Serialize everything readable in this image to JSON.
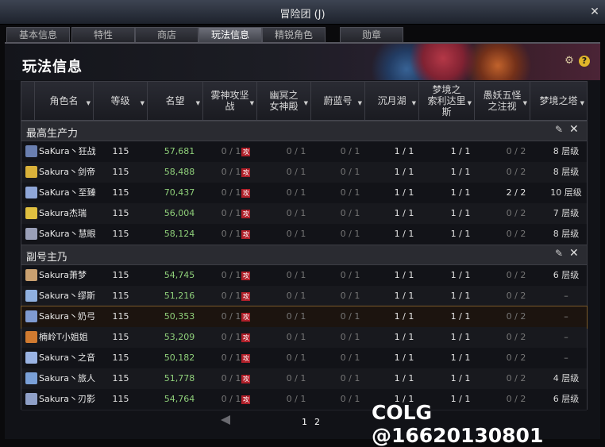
{
  "window": {
    "title": "冒险团 (J)",
    "close_glyph": "✕"
  },
  "tabs": [
    {
      "label": "基本信息"
    },
    {
      "label": "特性"
    },
    {
      "label": "商店"
    },
    {
      "label": "玩法信息"
    },
    {
      "label": "精锐角色"
    },
    {
      "label": "勋章"
    }
  ],
  "page_title": "玩法信息",
  "columns": [
    {
      "label": "角色名"
    },
    {
      "label": "等级"
    },
    {
      "label": "名望"
    },
    {
      "label": "雾神攻坚\n战"
    },
    {
      "label": "幽冥之\n女神殿"
    },
    {
      "label": "蔚蓝号"
    },
    {
      "label": "沉月湖"
    },
    {
      "label": "梦境之\n索利达里\n斯"
    },
    {
      "label": "愚妖五怪\n之注视"
    },
    {
      "label": "梦境之塔"
    }
  ],
  "groups": [
    {
      "title": "最高生产力",
      "rows": [
        {
          "name": "SaKura丶狂战",
          "level": "115",
          "fame": "57,681",
          "c1": "0 / 1",
          "c2": "0 / 1",
          "c3": "0 / 1",
          "c4": "1 / 1",
          "c5": "1 / 1",
          "c6": "0 / 2",
          "tower": "8 层级",
          "avatar": "#6a7fb0"
        },
        {
          "name": "Sakura丶剑帝",
          "level": "115",
          "fame": "58,488",
          "c1": "0 / 1",
          "c2": "0 / 1",
          "c3": "0 / 1",
          "c4": "1 / 1",
          "c5": "1 / 1",
          "c6": "0 / 2",
          "tower": "8 层级",
          "avatar": "#d9b13a"
        },
        {
          "name": "SaKura丶至臻",
          "level": "115",
          "fame": "70,437",
          "c1": "0 / 1",
          "c2": "0 / 1",
          "c3": "0 / 1",
          "c4": "1 / 1",
          "c5": "1 / 1",
          "c6": "2 / 2",
          "tower": "10 层级",
          "avatar": "#8fa6d8"
        },
        {
          "name": "Sakura杰瑞",
          "level": "115",
          "fame": "56,004",
          "c1": "0 / 1",
          "c2": "0 / 1",
          "c3": "0 / 1",
          "c4": "1 / 1",
          "c5": "1 / 1",
          "c6": "0 / 2",
          "tower": "7 层级",
          "avatar": "#e0c040"
        },
        {
          "name": "SaKura丶慧眼",
          "level": "115",
          "fame": "58,124",
          "c1": "0 / 1",
          "c2": "0 / 1",
          "c3": "0 / 1",
          "c4": "1 / 1",
          "c5": "1 / 1",
          "c6": "0 / 2",
          "tower": "8 层级",
          "avatar": "#9aa0b8"
        }
      ]
    },
    {
      "title": "副号主乃",
      "rows": [
        {
          "name": "Sakura萧梦",
          "level": "115",
          "fame": "54,745",
          "c1": "0 / 1",
          "c2": "0 / 1",
          "c3": "0 / 1",
          "c4": "1 / 1",
          "c5": "1 / 1",
          "c6": "0 / 2",
          "tower": "6 层级",
          "avatar": "#c9a070"
        },
        {
          "name": "Sakura丶缪斯",
          "level": "115",
          "fame": "51,216",
          "c1": "0 / 1",
          "c2": "0 / 1",
          "c3": "0 / 1",
          "c4": "1 / 1",
          "c5": "1 / 1",
          "c6": "0 / 2",
          "tower": "–",
          "avatar": "#8fb0e0"
        },
        {
          "name": "Sakura丶奶弓",
          "level": "115",
          "fame": "50,353",
          "c1": "0 / 1",
          "c2": "0 / 1",
          "c3": "0 / 1",
          "c4": "1 / 1",
          "c5": "1 / 1",
          "c6": "0 / 2",
          "tower": "–",
          "avatar": "#7f9ad0"
        },
        {
          "name": "楠岭T小姐姐",
          "level": "115",
          "fame": "53,209",
          "c1": "0 / 1",
          "c2": "0 / 1",
          "c3": "0 / 1",
          "c4": "1 / 1",
          "c5": "1 / 1",
          "c6": "0 / 2",
          "tower": "–",
          "avatar": "#d07a30"
        },
        {
          "name": "Sakura丶之音",
          "level": "115",
          "fame": "50,182",
          "c1": "0 / 1",
          "c2": "0 / 1",
          "c3": "0 / 1",
          "c4": "1 / 1",
          "c5": "1 / 1",
          "c6": "0 / 2",
          "tower": "–",
          "avatar": "#9ab4e4"
        },
        {
          "name": "Sakura丶旅人",
          "level": "115",
          "fame": "51,778",
          "c1": "0 / 1",
          "c2": "0 / 1",
          "c3": "0 / 1",
          "c4": "1 / 1",
          "c5": "1 / 1",
          "c6": "0 / 2",
          "tower": "4 层级",
          "avatar": "#7aa0d8"
        },
        {
          "name": "Sakura丶刃影",
          "level": "115",
          "fame": "54,764",
          "c1": "0 / 1",
          "c2": "0 / 1",
          "c3": "0 / 1",
          "c4": "1 / 1",
          "c5": "1 / 1",
          "c6": "0 / 2",
          "tower": "6 层级",
          "avatar": "#8fa0c8"
        }
      ]
    }
  ],
  "raid_tag": "攻",
  "pagination": {
    "pages": [
      "1",
      "2"
    ],
    "current": "1"
  },
  "watermark": "COLG @16620130801",
  "colors": {
    "fame": "#8fd07a",
    "accent": "#e0b52a",
    "tag": "#b0202a"
  }
}
